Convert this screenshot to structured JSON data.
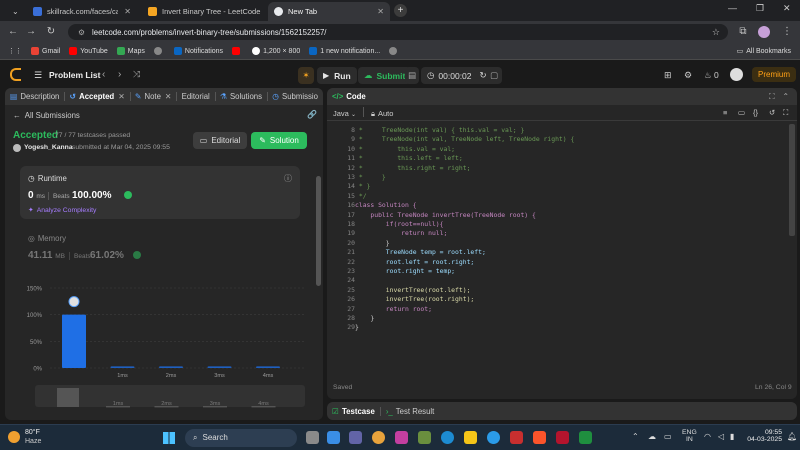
{
  "browser": {
    "tabs": [
      {
        "label": "skillrack.com/faces/candidate/",
        "active": false
      },
      {
        "label": "Invert Binary Tree - LeetCode",
        "active": false
      },
      {
        "label": "New Tab",
        "active": true
      }
    ],
    "url": "leetcode.com/problems/invert-binary-tree/submissions/1562152257/",
    "bookmarks": [
      "Gmail",
      "YouTube",
      "Maps",
      "Notifications",
      "1,200 × 800",
      "1 new notification..."
    ],
    "all_bookmarks": "All Bookmarks"
  },
  "lc_nav": {
    "problem_list": "Problem List",
    "run": "Run",
    "submit": "Submit",
    "timer": "00:00:02",
    "fire_count": "0",
    "premium": "Premium"
  },
  "left_panel": {
    "tabs": [
      "Description",
      "Accepted",
      "Note",
      "Editorial",
      "Solutions",
      "Submissio"
    ],
    "back_link": "All Submissions",
    "status": "Accepted",
    "testcases": "77 / 77 testcases passed",
    "author": "Yogesh_Kanna",
    "submitted": "submitted at Mar 04, 2025 09:55",
    "editorial_btn": "Editorial",
    "solution_btn": "Solution",
    "runtime": {
      "label": "Runtime",
      "value": "0",
      "unit": "ms",
      "beats_label": "Beats",
      "beats": "100.00%",
      "analyze": "Analyze Complexity"
    },
    "memory": {
      "label": "Memory",
      "value": "41.11",
      "unit": "MB",
      "beats_label": "Beats",
      "beats": "61.02%"
    }
  },
  "chart_data": {
    "type": "bar",
    "yticks": [
      "150%",
      "100%",
      "50%",
      "0%"
    ],
    "ylim": [
      0,
      150
    ],
    "categories": [
      "",
      "1ms",
      "2ms",
      "3ms",
      "4ms"
    ],
    "values": [
      100,
      3,
      3,
      3,
      3
    ],
    "highlight_color": "#1f6fe5",
    "minimap_labels": [
      "1ms",
      "2ms",
      "3ms",
      "4ms"
    ]
  },
  "code_panel": {
    "title": "Code",
    "language": "Java",
    "mode": "Auto",
    "saved": "Saved",
    "cursor": "Ln 26, Col 9",
    "lines": [
      {
        "n": "8",
        "t": " *     TreeNode(int val) { this.val = val; }",
        "c": "cm"
      },
      {
        "n": "9",
        "t": " *     TreeNode(int val, TreeNode left, TreeNode right) {",
        "c": "cm"
      },
      {
        "n": "10",
        "t": " *         this.val = val;",
        "c": "cm"
      },
      {
        "n": "11",
        "t": " *         this.left = left;",
        "c": "cm"
      },
      {
        "n": "12",
        "t": " *         this.right = right;",
        "c": "cm"
      },
      {
        "n": "13",
        "t": " *     }",
        "c": "cm"
      },
      {
        "n": "14",
        "t": " * }",
        "c": "cm"
      },
      {
        "n": "15",
        "t": " */",
        "c": "cm"
      },
      {
        "n": "16",
        "t": "class Solution {",
        "c": "kw"
      },
      {
        "n": "17",
        "t": "    public TreeNode invertTree(TreeNode root) {",
        "c": "kw"
      },
      {
        "n": "18",
        "t": "        if(root==null){",
        "c": "kw"
      },
      {
        "n": "19",
        "t": "            return null;",
        "c": "kw"
      },
      {
        "n": "20",
        "t": "        }",
        "c": ""
      },
      {
        "n": "21",
        "t": "        TreeNode temp = root.left;",
        "c": "vr"
      },
      {
        "n": "22",
        "t": "        root.left = root.right;",
        "c": "vr"
      },
      {
        "n": "23",
        "t": "        root.right = temp;",
        "c": "vr"
      },
      {
        "n": "24",
        "t": "",
        "c": ""
      },
      {
        "n": "25",
        "t": "        invertTree(root.left);",
        "c": "fn"
      },
      {
        "n": "26",
        "t": "        invertTree(root.right);",
        "c": "fn"
      },
      {
        "n": "27",
        "t": "        return root;",
        "c": "kw"
      },
      {
        "n": "28",
        "t": "    }",
        "c": ""
      },
      {
        "n": "29",
        "t": "}",
        "c": ""
      }
    ]
  },
  "bottom_panel": {
    "testcase": "Testcase",
    "test_result": "Test Result"
  },
  "taskbar": {
    "weather_temp": "80°F",
    "weather_desc": "Haze",
    "search": "Search",
    "lang": "ENG",
    "region": "IN",
    "time": "09:55",
    "date": "04-03-2025"
  }
}
